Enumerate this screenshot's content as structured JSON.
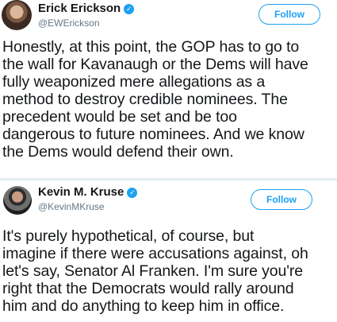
{
  "tweets": [
    {
      "author": "Erick Erickson",
      "handle": "@EWErickson",
      "follow_label": "Follow",
      "verified_icon": "verified-badge-icon",
      "lines": [
        "Honestly, at this point, the GOP has to go to",
        "the wall for Kavanaugh or the Dems will have",
        "fully weaponized mere allegations as a",
        "method to destroy credible nominees. The",
        "precedent would be set and be too",
        "dangerous to future nominees. And we know",
        "the Dems would defend their own."
      ]
    },
    {
      "author": "Kevin M. Kruse",
      "handle": "@KevinMKruse",
      "follow_label": "Follow",
      "verified_icon": "verified-badge-icon",
      "lines": [
        "It's purely hypothetical, of course, but",
        "imagine if there were accusations against, oh",
        "let's say, Senator Al Franken. I'm sure you're",
        "right that the Democrats would rally around",
        "him and do anything to keep him in office."
      ]
    }
  ],
  "colors": {
    "accent": "#1da1f2",
    "text": "#14171a",
    "muted": "#657786"
  }
}
